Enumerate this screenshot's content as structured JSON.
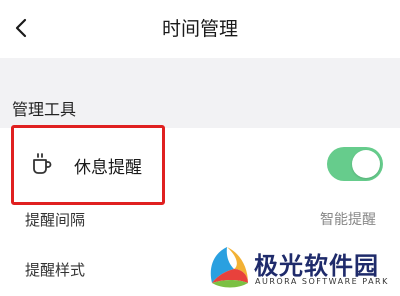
{
  "header": {
    "title": "时间管理"
  },
  "section": {
    "title": "管理工具"
  },
  "rest_reminder": {
    "label": "休息提醒",
    "enabled": true,
    "icon": "cup-icon"
  },
  "interval": {
    "label": "提醒间隔",
    "value": "智能提醒"
  },
  "style": {
    "label": "提醒样式"
  },
  "watermark": {
    "name": "极光软件园",
    "sub": "AURORA SOFTWARE PARK"
  },
  "colors": {
    "toggle_on": "#66cc8c",
    "highlight": "#e02020",
    "background": "#f2f2f4"
  }
}
